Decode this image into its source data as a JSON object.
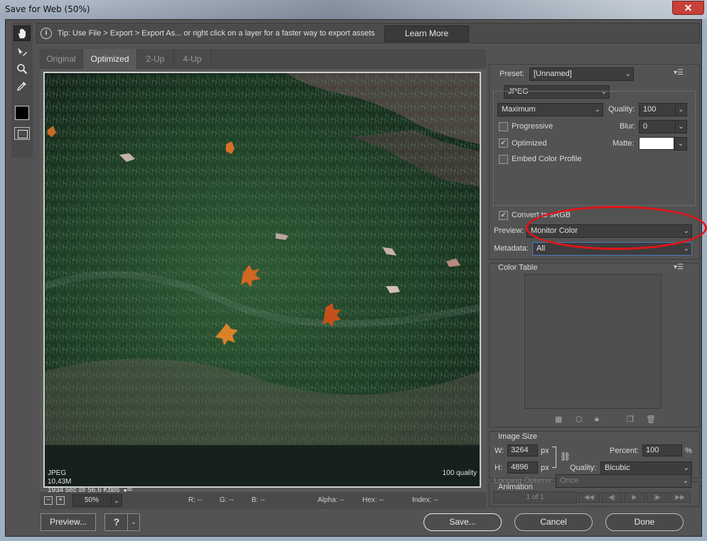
{
  "window": {
    "title": "Save for Web (50%)",
    "close_glyph": "✕"
  },
  "tip": {
    "text": "Tip: Use File > Export > Export As...  or right click on a layer for a faster way to export assets",
    "learn_more": "Learn More"
  },
  "tabs": [
    "Original",
    "Optimized",
    "2-Up",
    "4-Up"
  ],
  "selected_tab": "Optimized",
  "image_info": {
    "format": "JPEG",
    "size": "10,43M",
    "time": "1934 sec @ 56.6 Kbps",
    "quality": "100 quality"
  },
  "status": {
    "zoom": "50%",
    "r": "R: --",
    "g": "G: --",
    "b": "B: --",
    "alpha": "Alpha: --",
    "hex": "Hex: --",
    "index": "Index: --"
  },
  "buttons": {
    "preview": "Preview...",
    "save": "Save...",
    "cancel": "Cancel",
    "done": "Done",
    "help_glyph": "?"
  },
  "preset": {
    "label": "Preset:",
    "value": "[Unnamed]",
    "format": "JPEG",
    "compression": "Maximum",
    "quality_label": "Quality:",
    "quality": "100",
    "progressive": "Progressive",
    "blur_label": "Blur:",
    "blur": "0",
    "optimized": "Optimized",
    "matte_label": "Matte:",
    "embed_profile": "Embed Color Profile",
    "convert_srgb": "Convert to sRGB",
    "preview_label": "Preview:",
    "preview_value": "Monitor Color",
    "metadata_label": "Metadata:",
    "metadata_value": "All"
  },
  "color_table": {
    "title": "Color Table"
  },
  "image_size": {
    "title": "Image Size",
    "w_label": "W:",
    "w": "3264",
    "h_label": "H:",
    "h": "4896",
    "unit": "px",
    "percent_label": "Percent:",
    "percent": "100",
    "percent_unit": "%",
    "quality_label": "Quality:",
    "quality": "Bicubic"
  },
  "animation": {
    "title": "Animation",
    "looping_label": "Looping Options:",
    "looping": "Once",
    "frame": "1 of 1"
  },
  "colors": {
    "panel": "#535353",
    "highlight": "#e0141a",
    "field": "#3d3d3d"
  }
}
